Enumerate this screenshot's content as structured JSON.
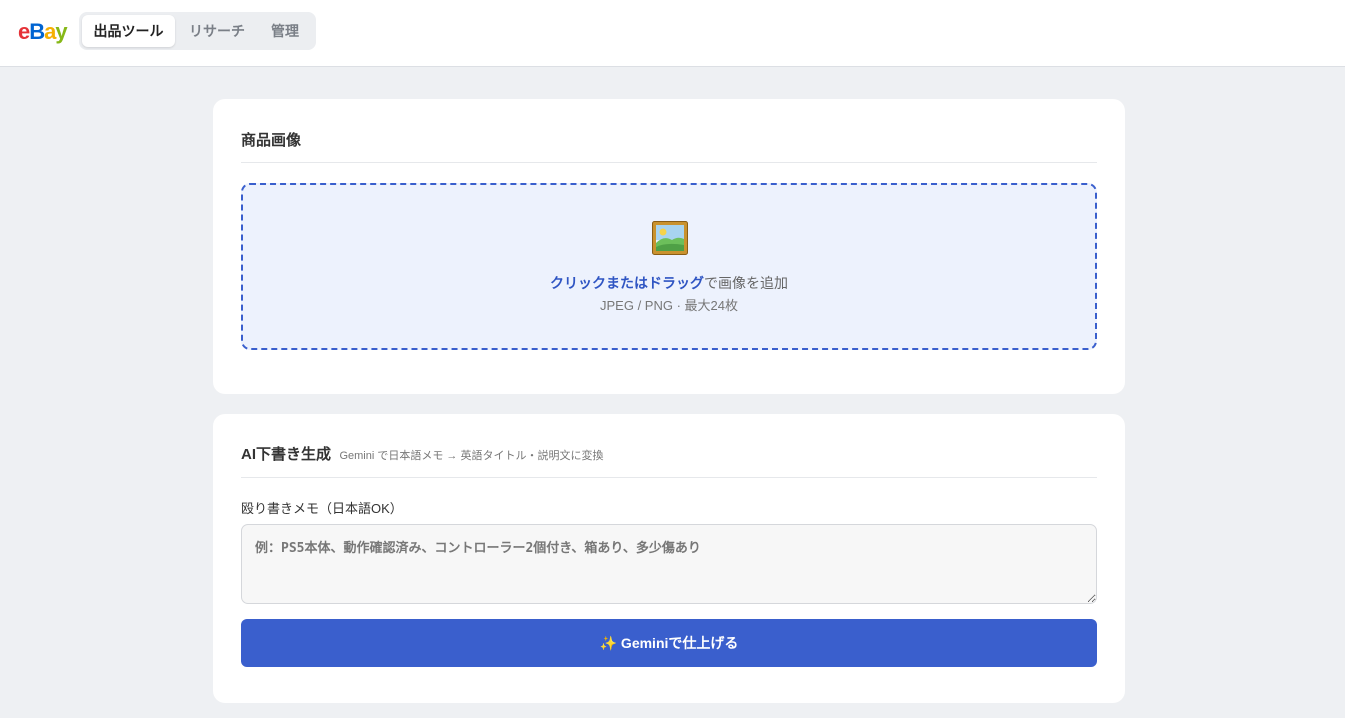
{
  "header": {
    "logo": {
      "l1": "e",
      "l2": "B",
      "l3": "a",
      "l4": "y"
    },
    "tabs": [
      {
        "label": "出品ツール",
        "active": true
      },
      {
        "label": "リサーチ",
        "active": false
      },
      {
        "label": "管理",
        "active": false
      }
    ]
  },
  "images_section": {
    "title": "商品画像",
    "dropzone": {
      "icon": "framed-picture-icon",
      "link_text": "クリックまたはドラッグ",
      "rest_text": "で画像を追加",
      "hint": "JPEG / PNG · 最大24枚"
    }
  },
  "ai_section": {
    "title": "AI下書き生成",
    "subtitle": "Gemini で日本語メモ → 英語タイトル・説明文に変換",
    "memo_label": "殴り書きメモ（日本語OK）",
    "memo_placeholder": "例：PS5本体、動作確認済み、コントローラー2個付き、箱あり、多少傷あり",
    "memo_value": "",
    "button_label": "✨ Geminiで仕上げる"
  },
  "colors": {
    "accent": "#3a5fcd",
    "dropzone_bg": "#edf2fd",
    "page_bg": "#eef0f3"
  }
}
